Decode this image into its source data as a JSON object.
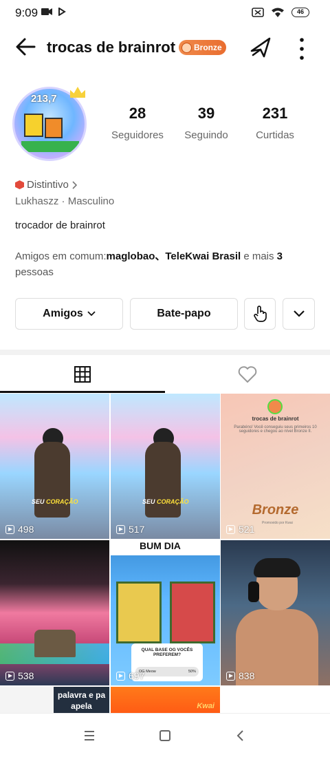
{
  "status_bar": {
    "time": "9:09",
    "battery": "46"
  },
  "header": {
    "title": "trocas de brainrot",
    "badge": "Bronze"
  },
  "profile": {
    "avatar_text": "213,7",
    "stats": [
      {
        "value": "28",
        "label": "Seguidores"
      },
      {
        "value": "39",
        "label": "Seguindo"
      },
      {
        "value": "231",
        "label": "Curtidas"
      }
    ],
    "distintivo": "Distintivo",
    "meta": "Lukhaszz · Masculino",
    "bio": "trocador de brainrot",
    "friends_prefix": "Amigos em comum:",
    "friends_names": "maglobao、TeleKwai Brasil",
    "friends_mid": " e mais ",
    "friends_count": "3",
    "friends_suffix": " pessoas"
  },
  "actions": {
    "friends_label": "Amigos",
    "chat_label": "Bate-papo"
  },
  "colors": {
    "badge": "#e96d2f",
    "bronze_text": "#b46a2f",
    "accent_underline": "#111111"
  },
  "videos": [
    {
      "views": "498",
      "caption_a": "SEU ",
      "caption_b": "CORAÇÃO"
    },
    {
      "views": "517",
      "caption_a": "SEU ",
      "caption_b": "CORAÇÃO"
    },
    {
      "views": "521",
      "title": "trocas de brainrot",
      "text": "Parabéns! Você conseguiu seus primeiros 10 seguidores e chegou ao nível Bronze II.",
      "big": "Bronze",
      "promo": "Promovido por Kwai"
    },
    {
      "views": "538"
    },
    {
      "views": "697",
      "headline": "BUM DIA",
      "question": "QUAL BASE OG VOCÊS PREFEREM?",
      "option": "OG Meow",
      "percent": "50%"
    },
    {
      "views": "838"
    },
    {
      "text": "palavra e pa apela"
    },
    {
      "text": "Kwai"
    }
  ],
  "icons": {
    "back": "arrow-left-icon",
    "share": "share-arrow-icon",
    "more": "more-vertical-icon",
    "grid": "grid-icon",
    "likes": "heart-icon",
    "touch": "touch-hand-icon",
    "expand": "chevron-down-icon"
  }
}
